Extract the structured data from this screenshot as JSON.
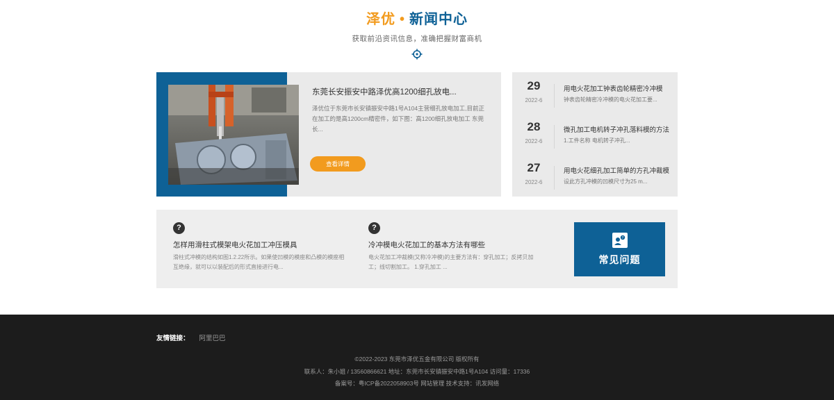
{
  "header": {
    "brand": "泽优",
    "separator": "•",
    "section_title": "新闻中心",
    "subtitle": "获取前沿资讯信息，准确把握财富商机"
  },
  "featured": {
    "title": "东莞长安振安中路泽优高1200细孔放电...",
    "description": "泽优位于东莞市长安镇振安中路1号A104主营细孔放电加工,目前正在加工的是高1200cm精密件，如下图：高1200细孔放电加工 东莞长...",
    "more_label": "查看详情"
  },
  "news": [
    {
      "day": "29",
      "ym": "2022-6",
      "title": "用电火花加工钟表齿轮精密冷冲模",
      "summary": "钟表齿轮精密冷冲模的电火花加工要..."
    },
    {
      "day": "28",
      "ym": "2022-6",
      "title": "微孔加工电机转子冲孔落料模的方法",
      "summary": "1.工件名称 电机转子冲孔..."
    },
    {
      "day": "27",
      "ym": "2022-6",
      "title": "用电火花细孔加工简单的方孔冲裁模",
      "summary": "设此方孔冲模的凹模尺寸为25 m..."
    }
  ],
  "faq": {
    "items": [
      {
        "title": "怎样用滑柱式模架电火花加工冲压模具",
        "desc": "滑柱式冲模的结构如图1.2.22所示。如果使凹模的模座和凸模的模座相互绝缘，就可以以装配后的形式直接进行电..."
      },
      {
        "title": "冷冲模电火花加工的基本方法有哪些",
        "desc": "电火花加工冲裁模(又称冷冲模)的主要方法有：穿孔加工；反拷贝加工；线切割加工。 1.穿孔加工 ..."
      }
    ],
    "card_label": "常见问题"
  },
  "footer": {
    "links_label": "友情链接：",
    "links": [
      "阿里巴巴"
    ],
    "copyright": "©2022-2023 东莞市泽优五金有限公司 版权所有",
    "contact": "联系人：朱小姐 / 13560866621 地址：东莞市长安镇振安中路1号A104 访问量：17336",
    "icp": "备案号：粤ICP备2022058903号 网站管理 技术支持：讯发网络"
  },
  "colors": {
    "accent_orange": "#f29b1e",
    "brand_blue": "#0e6196",
    "footer_bg": "#1c1c1c",
    "panel_bg": "#eaeaea"
  },
  "icons": {
    "target": "crosshair-target-icon",
    "question": "question-circle-icon",
    "faq_card": "people-question-icon"
  }
}
